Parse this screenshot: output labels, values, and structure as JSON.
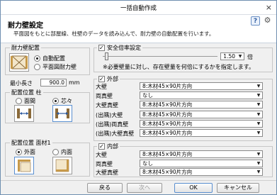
{
  "window": {
    "title": "一括自動作成",
    "close_glyph": "×"
  },
  "header": {
    "title": "耐力壁設定",
    "subtitle": "平面図をもとに部屋線、柱壁のデータを読み込んで、耐力壁の自動配置を行います。",
    "help_label": "?",
    "settings_glyph": "⚙"
  },
  "placement": {
    "legend": "耐力壁配置",
    "auto_label": "自動配置",
    "plan_label": "平面図耐力壁",
    "selected": "auto"
  },
  "min_length": {
    "label": "最小長さ",
    "value": "900.0",
    "unit": "mm"
  },
  "column_position": {
    "legend": "配置位置 柱",
    "face_label": "面間",
    "center_label": "芯々",
    "selected": "center"
  },
  "face_position": {
    "legend": "配置位置 面材1",
    "outer_label": "外面",
    "inner_label": "内面",
    "selected": "outer"
  },
  "safety": {
    "label": "安全倍率設定",
    "checked": true,
    "slider_fraction": 0.02,
    "value": "1.50",
    "unit": "倍",
    "note": "※必要壁量に対し、存在壁量を何倍にするかを指定します。"
  },
  "exterior": {
    "label": "外部",
    "checked": true,
    "rows": [
      {
        "label": "大壁",
        "value": "8:木材45×90片方向"
      },
      {
        "label": "両真壁",
        "value": "なし"
      },
      {
        "label": "大壁真壁",
        "value": "8:木材45×90片方向"
      },
      {
        "label": "(出隅)大壁",
        "value": "8:木材45×90片方向"
      },
      {
        "label": "(出隅)両真壁",
        "value": "8:木材45×90片方向"
      },
      {
        "label": "(出隅)大壁真壁",
        "value": "8:木材45×90片方向"
      }
    ]
  },
  "interior": {
    "label": "内部",
    "checked": true,
    "rows": [
      {
        "label": "大壁",
        "value": "8:木材45×90片方向"
      },
      {
        "label": "両真壁",
        "value": "なし"
      },
      {
        "label": "大壁真壁",
        "value": "8:木材45×90片方向"
      }
    ]
  },
  "footer": {
    "back_label": "戻る",
    "next_label": "次へ",
    "ok_label": "OK",
    "cancel_label": "キャンセル"
  },
  "colors": {
    "accent": "#2c5aa0",
    "window_border": "#6f8fb0",
    "panel": "#f0f0f0"
  },
  "icons": [
    "help-icon",
    "settings-icon",
    "wall-placement-icon",
    "column-face-icon",
    "column-center-icon",
    "face-outer-icon",
    "face-inner-icon",
    "dropdown-arrow-icon"
  ]
}
